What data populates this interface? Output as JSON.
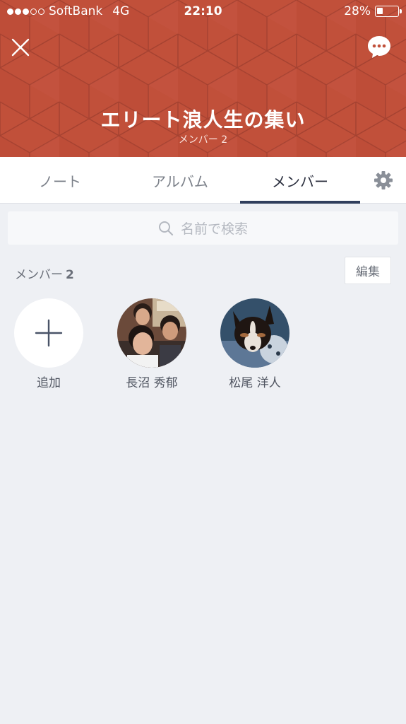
{
  "status_bar": {
    "carrier": "SoftBank",
    "network": "4G",
    "time": "22:10",
    "battery": "28%",
    "battery_level": 0.28,
    "signal_bars_filled": 3,
    "signal_bars_total": 5
  },
  "header": {
    "title": "エリート浪人生の集い",
    "subtitle": "メンバー 2",
    "background_color": "#c1503a"
  },
  "tabs": [
    {
      "label": "ノート",
      "active": false
    },
    {
      "label": "アルバム",
      "active": false
    },
    {
      "label": "メンバー",
      "active": true
    }
  ],
  "search": {
    "placeholder": "名前で検索"
  },
  "members_section": {
    "label": "メンバー",
    "count": "2",
    "edit_label": "編集"
  },
  "members": [
    {
      "name": "追加",
      "type": "add"
    },
    {
      "name": "長沼 秀郁",
      "type": "photo-group"
    },
    {
      "name": "松尾 洋人",
      "type": "photo-dog"
    }
  ],
  "icons": {
    "close": "close-icon",
    "chat": "chat-bubble-icon",
    "settings": "gear-icon",
    "search": "search-icon",
    "add": "plus-icon"
  }
}
